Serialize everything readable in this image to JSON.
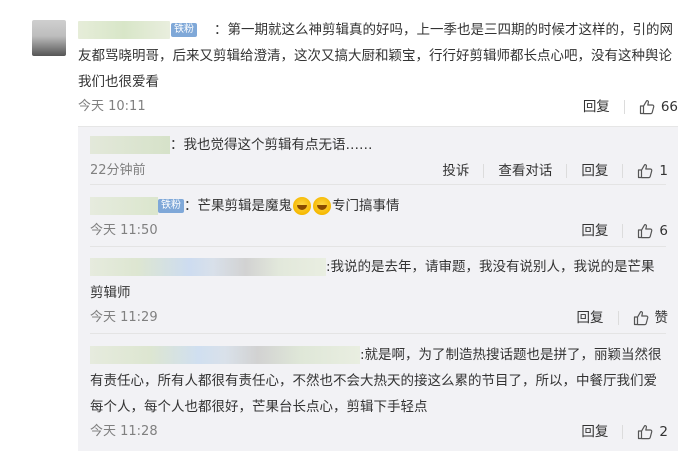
{
  "main": {
    "badge": "铁粉",
    "text": "：第一期就这么神剪辑真的好吗，上一季也是三四期的时候才这样的，引的网友都骂晓明哥，后来又剪辑给澄清，这次又搞大厨和颖宝，行行好剪辑师都长点心吧，没有这种舆论我们也很爱看",
    "time": "今天 10:11",
    "reply_label": "回复",
    "like_count": "66"
  },
  "replies": [
    {
      "text": "：我也觉得这个剪辑有点无语……",
      "time": "22分钟前",
      "report_label": "投诉",
      "view_dialog_label": "查看对话",
      "reply_label": "回复",
      "like_count": "1"
    },
    {
      "badge": "铁粉",
      "text_before": "：芒果剪辑是魔鬼",
      "text_after": "专门搞事情",
      "emoji": "laugh-cry-emoji",
      "time": "今天 11:50",
      "reply_label": "回复",
      "like_count": "6"
    },
    {
      "text": ":我说的是去年，请审题，我没有说别人，我说的是芒果剪辑师",
      "time": "今天 11:29",
      "reply_label": "回复",
      "like_count": "赞"
    },
    {
      "text": ":就是啊，为了制造热搜话题也是拼了，丽颖当然很有责任心，所有人都很有责任心，不然也不会大热天的接这么累的节目了，所以，中餐厅我们爱每个人，每个人也都很好，芒果台长点心，剪辑下手轻点",
      "time": "今天 11:28",
      "reply_label": "回复",
      "like_count": "2"
    }
  ],
  "colors": {
    "badge_bg": "#7fa8d8",
    "reply_panel_bg": "#f2f2f5",
    "meta_gray": "#808080"
  }
}
